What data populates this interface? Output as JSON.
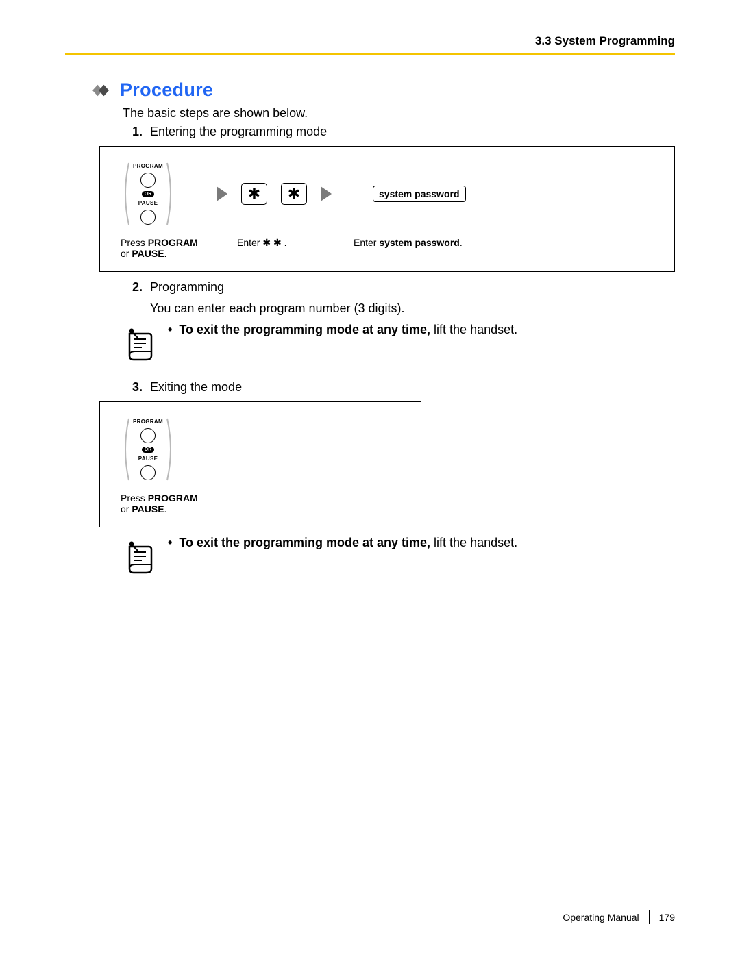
{
  "header": {
    "section": "3.3 System Programming"
  },
  "title": "Procedure",
  "intro": "The basic steps are shown below.",
  "steps": {
    "s1": {
      "num": "1.",
      "text": "Entering the programming mode"
    },
    "s2": {
      "num": "2.",
      "text": "Programming",
      "sub": "You can enter each program number (3 digits)."
    },
    "s3": {
      "num": "3.",
      "text": "Exiting the mode"
    }
  },
  "diagram1": {
    "btn_top": "PROGRAM",
    "btn_or": "OR",
    "btn_bottom": "PAUSE",
    "star": "✱",
    "password_box": "system password",
    "cap_a_pre": "Press ",
    "cap_a_b1": "PROGRAM",
    "cap_a_mid": "or ",
    "cap_a_b2": "PAUSE",
    "cap_a_post": ".",
    "cap_b_pre": "Enter ",
    "cap_b_stars": "✱ ✱",
    "cap_b_post": " .",
    "cap_c_pre": "Enter ",
    "cap_c_b": "system password",
    "cap_c_post": "."
  },
  "diagram2": {
    "btn_top": "PROGRAM",
    "btn_or": "OR",
    "btn_bottom": "PAUSE",
    "cap_a_pre": "Press ",
    "cap_a_b1": "PROGRAM",
    "cap_a_mid": "or ",
    "cap_a_b2": "PAUSE",
    "cap_a_post": "."
  },
  "note": {
    "bold": "To exit the programming mode at any time,",
    "rest": " lift the handset."
  },
  "footer": {
    "manual": "Operating Manual",
    "page": "179"
  }
}
